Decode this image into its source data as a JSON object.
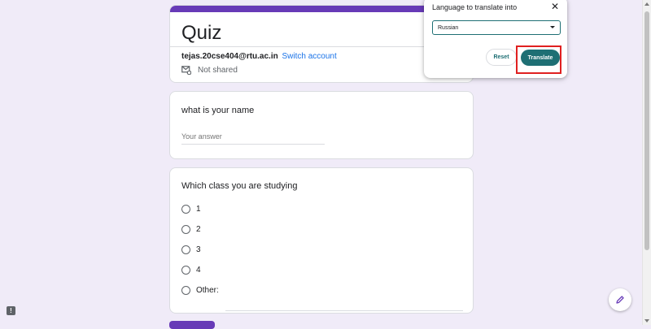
{
  "form": {
    "title": "Quiz",
    "account_email": "tejas.20cse404@rtu.ac.in",
    "switch_account": "Switch account",
    "shared_status": "Not shared"
  },
  "questions": [
    {
      "title": "what is your name",
      "placeholder": "Your answer"
    },
    {
      "title": "Which class you are studying",
      "options": [
        "1",
        "2",
        "3",
        "4"
      ],
      "other_label": "Other:"
    }
  ],
  "translate_popup": {
    "title": "Language to translate into",
    "selected_language": "Russian",
    "reset_label": "Reset",
    "translate_label": "Translate"
  },
  "colors": {
    "accent": "#673ab7",
    "background": "#f0ebf8",
    "translate_button": "#1e6f74",
    "highlight": "#e02020",
    "link": "#1a73e8"
  },
  "icons": {
    "close": "close-icon",
    "shared": "mail-shared-icon",
    "edit": "pencil-icon",
    "report": "report-icon",
    "dropdown": "caret-down-icon"
  }
}
